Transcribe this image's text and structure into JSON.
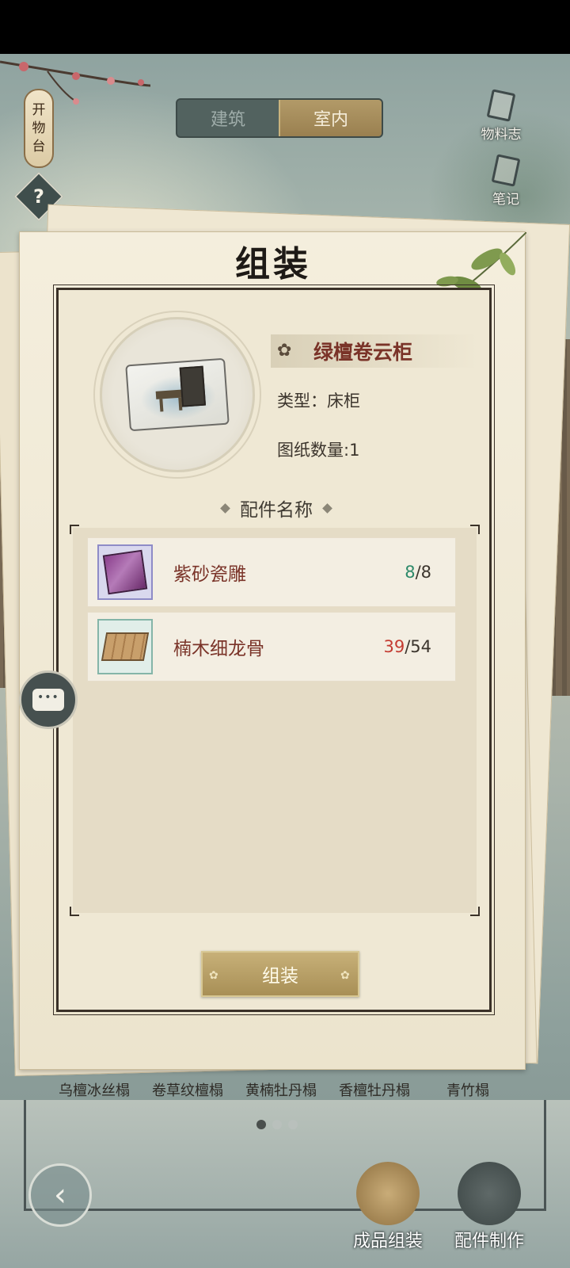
{
  "left_sign": {
    "chars": [
      "开",
      "物",
      "台"
    ]
  },
  "help": {
    "glyph": "?"
  },
  "tabs": [
    {
      "label": "建筑",
      "active": false
    },
    {
      "label": "室内",
      "active": true
    }
  ],
  "side_buttons": [
    {
      "label": "物料志",
      "icon": "book-icon"
    },
    {
      "label": "笔记",
      "icon": "notes-icon"
    }
  ],
  "panel": {
    "title": "组装",
    "item": {
      "name": "绿檀卷云柜",
      "type_text": "类型：床柜",
      "blueprint_count_text": "图纸数量:1"
    },
    "parts_header": "配件名称",
    "parts": [
      {
        "name": "紫砂瓷雕",
        "have": "8",
        "need": "/8",
        "status": "ok",
        "icon": "purple-carving-icon"
      },
      {
        "name": "楠木细龙骨",
        "have": "39",
        "need": "/54",
        "status": "low",
        "icon": "wood-keel-icon"
      }
    ],
    "assemble_label": "组装"
  },
  "shelf_items": [
    "乌檀冰丝榻",
    "卷草纹檀榻",
    "黄楠牡丹榻",
    "香檀牡丹榻",
    "青竹榻"
  ],
  "pager": {
    "count": 3,
    "active_index": 0
  },
  "bottom_actions": [
    {
      "label": "成品组装"
    },
    {
      "label": "配件制作"
    }
  ],
  "colors": {
    "accent_gold": "#a88f56",
    "qty_ok": "#2e8a6a",
    "qty_low": "#c43c32",
    "part_name": "#7a3328"
  }
}
